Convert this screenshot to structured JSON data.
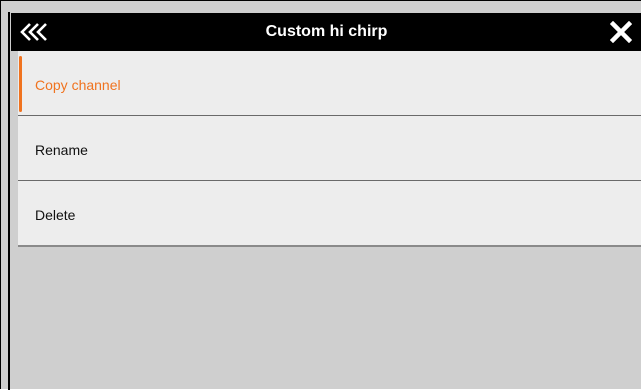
{
  "header": {
    "title": "Custom hi chirp",
    "back_icon": "double-chevron-left-icon",
    "close_icon": "close-icon"
  },
  "menu": {
    "items": [
      {
        "label": "Copy channel",
        "active": true
      },
      {
        "label": "Rename",
        "active": false
      },
      {
        "label": "Delete",
        "active": false
      }
    ]
  },
  "colors": {
    "accent": "#f0731f",
    "titlebar": "#000000",
    "menu_bg": "#ededed",
    "background": "#cfcfcf"
  }
}
